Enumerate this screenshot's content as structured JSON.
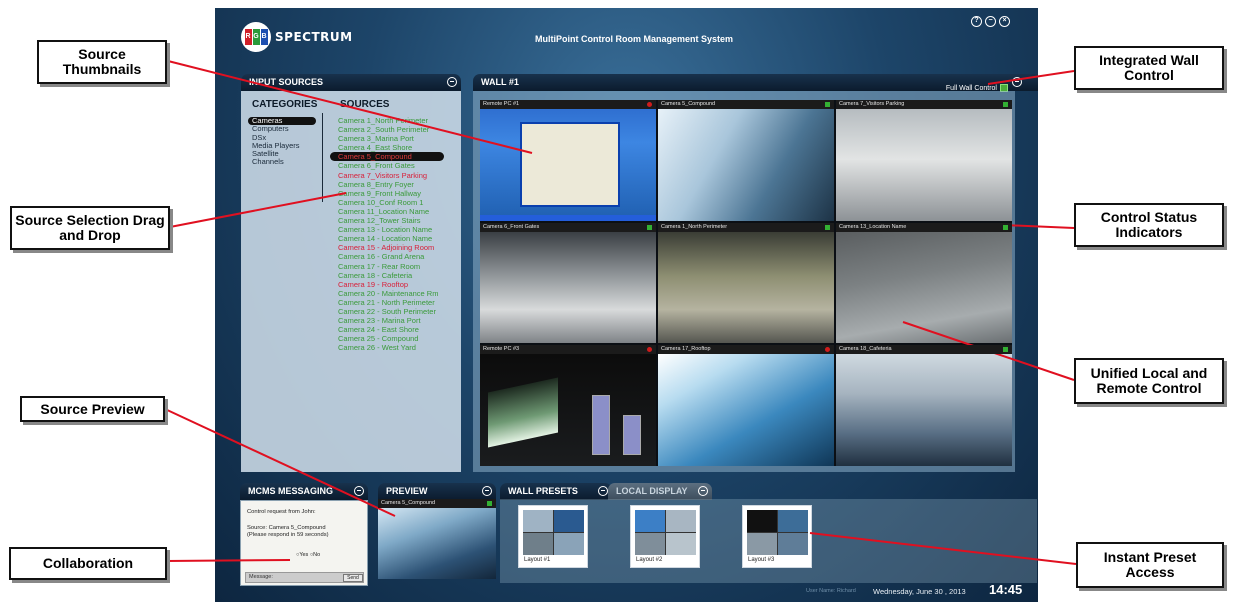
{
  "app": {
    "brand": "SPECTRUM",
    "brand_letters": [
      "R",
      "G",
      "B"
    ],
    "title": "MultiPoint Control Room Management System",
    "window_controls": [
      "help-icon",
      "minimize-icon",
      "close-icon"
    ]
  },
  "input_sources": {
    "header": "INPUT SOURCES",
    "categories_title": "CATEGORIES",
    "sources_title": "SOURCES",
    "categories": [
      {
        "label": "Cameras",
        "selected": true
      },
      {
        "label": "Computers",
        "selected": false
      },
      {
        "label": "DSx",
        "selected": false
      },
      {
        "label": "Media Players",
        "selected": false
      },
      {
        "label": "Satellite",
        "selected": false
      },
      {
        "label": "Channels",
        "selected": false
      }
    ],
    "sources": [
      {
        "label": "Camera 1_North Perimeter",
        "state": "available"
      },
      {
        "label": "Camera 2_South Perimeter",
        "state": "available"
      },
      {
        "label": "Camera 3_Marina Port",
        "state": "available"
      },
      {
        "label": "Camera 4_East Shore",
        "state": "available"
      },
      {
        "label": "Camera 5_Compound",
        "state": "selected"
      },
      {
        "label": "Camera 6_Front Gates",
        "state": "available"
      },
      {
        "label": "Camera 7_Visitors Parking",
        "state": "in-use"
      },
      {
        "label": "Camera 8_Entry Foyer",
        "state": "available"
      },
      {
        "label": "Camera 9_Front Hallway",
        "state": "available"
      },
      {
        "label": "Camera 10_Conf Room 1",
        "state": "available"
      },
      {
        "label": "Camera 11_Location Name",
        "state": "available"
      },
      {
        "label": "Camera 12_Tower Stairs",
        "state": "available"
      },
      {
        "label": "Camera 13 - Location Name",
        "state": "available"
      },
      {
        "label": "Camera 14 - Location Name",
        "state": "available"
      },
      {
        "label": "Camera 15 - Adjoining Room",
        "state": "in-use"
      },
      {
        "label": "Camera 16 - Grand Arena",
        "state": "available"
      },
      {
        "label": "Camera 17 - Rear Room",
        "state": "available"
      },
      {
        "label": "Camera 18 - Cafeteria",
        "state": "available"
      },
      {
        "label": "Camera 19 - Rooftop",
        "state": "in-use"
      },
      {
        "label": "Camera 20 - Maintenance Rm",
        "state": "available"
      },
      {
        "label": "Camera 21 - North Perimeter",
        "state": "available"
      },
      {
        "label": "Camera 22 - South Perimeter",
        "state": "available"
      },
      {
        "label": "Camera 23 - Marina Port",
        "state": "available"
      },
      {
        "label": "Camera 24 - East Shore",
        "state": "available"
      },
      {
        "label": "Camera 25 - Compound",
        "state": "available"
      },
      {
        "label": "Camera 26 - West Yard",
        "state": "available"
      }
    ]
  },
  "wall": {
    "header": "WALL #1",
    "full_wall_label": "Full Wall Control",
    "tiles": [
      {
        "label": "Remote PC #1",
        "indicator": "red",
        "scene": "desktop"
      },
      {
        "label": "Camera 5_Compound",
        "indicator": "green",
        "scene": "corridor"
      },
      {
        "label": "Camera 7_Visitors Parking",
        "indicator": "green",
        "scene": "parking"
      },
      {
        "label": "Camera 6_Front Gates",
        "indicator": "green",
        "scene": "garage"
      },
      {
        "label": "Camera 1_North Perimeter",
        "indicator": "green",
        "scene": "parking-dark"
      },
      {
        "label": "Camera 13_Location Name",
        "indicator": "green",
        "scene": "ramp"
      },
      {
        "label": "Remote PC #3",
        "indicator": "red",
        "scene": "dashboard"
      },
      {
        "label": "Camera 17_Rooftop",
        "indicator": "red",
        "scene": "glass"
      },
      {
        "label": "Camera 18_Cafeteria",
        "indicator": "green",
        "scene": "crowd"
      }
    ]
  },
  "messaging": {
    "header": "MCMS MESSAGING",
    "line1": "Control request from John:",
    "line2": "Source: Camera 5_Compound",
    "line3": "(Please respond in 59 seconds)",
    "yes_label": "Yes",
    "no_label": "No",
    "message_label": "Message:",
    "send_label": "Send"
  },
  "preview": {
    "header": "PREVIEW",
    "source_label": "Camera 5_Compound"
  },
  "presets": {
    "header": "WALL PRESETS",
    "local_display_label": "LOCAL DISPLAY",
    "items": [
      {
        "label": "Layout #1"
      },
      {
        "label": "Layout #2"
      },
      {
        "label": "Layout #3"
      }
    ]
  },
  "footer": {
    "user": "User Name: Richard",
    "date": "Wednesday, June 30 , 2013",
    "time": "14:45"
  },
  "callouts": {
    "source_thumbnails": "Source Thumbnails",
    "source_selection": "Source Selection Drag and Drop",
    "source_preview": "Source Preview",
    "collaboration": "Collaboration",
    "integrated_wall": "Integrated Wall Control",
    "control_status": "Control Status Indicators",
    "unified_control": "Unified Local and Remote Control",
    "instant_preset": "Instant Preset Access"
  },
  "colors": {
    "available_source": "#3a9a3a",
    "in_use_source": "#d8203a",
    "indicator_green": "#33b033",
    "indicator_red": "#d01c1c",
    "brand_red": "#d0202a",
    "brand_green": "#2a9a3a",
    "brand_blue": "#1d4fb0"
  }
}
